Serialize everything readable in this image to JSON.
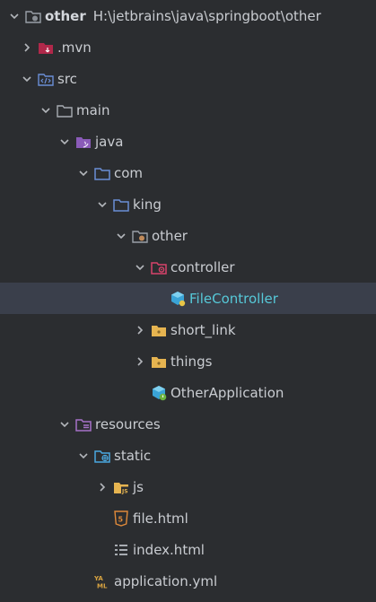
{
  "tree": {
    "project": {
      "label": "other",
      "path": "H:\\jetbrains\\java\\springboot\\other"
    },
    "mvn": {
      "label": ".mvn"
    },
    "src": {
      "label": "src"
    },
    "main": {
      "label": "main"
    },
    "java": {
      "label": "java"
    },
    "com": {
      "label": "com"
    },
    "king": {
      "label": "king"
    },
    "other_pkg": {
      "label": "other"
    },
    "controller": {
      "label": "controller"
    },
    "file_controller": {
      "label": "FileController"
    },
    "short_link": {
      "label": "short_link"
    },
    "things": {
      "label": "things"
    },
    "other_application": {
      "label": "OtherApplication"
    },
    "resources": {
      "label": "resources"
    },
    "static_dir": {
      "label": "static"
    },
    "js_dir": {
      "label": "js"
    },
    "file_html": {
      "label": "file.html"
    },
    "index_html": {
      "label": "index.html"
    },
    "application_yml": {
      "label": "application.yml"
    }
  },
  "colors": {
    "background": "#2b2d30",
    "selected_row": "#3a3f4b",
    "active_text": "#56c8d8",
    "text": "#c9ccd1"
  }
}
